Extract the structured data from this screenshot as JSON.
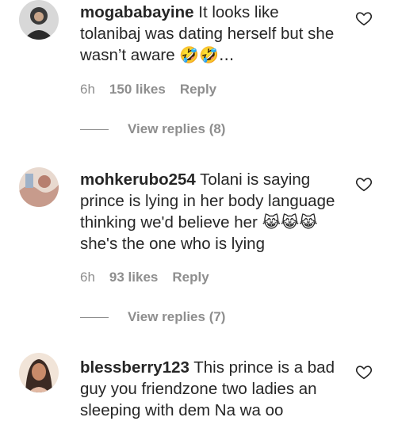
{
  "comments": [
    {
      "username": "mogababayine",
      "text": "It looks like tolanibaj was dating herself but she wasn’t aware",
      "emoji_trail": "🤣🤣...",
      "time": "6h",
      "likes": "150 likes",
      "reply": "Reply",
      "view_replies": "View replies (8)",
      "avatar_icon": "profile-avatar-icon"
    },
    {
      "username": "mohkerubo254",
      "text_line1": "Tolani is saying prince is lying in her body language thinking we'd believe her",
      "emoji_lead": "😹😹😹",
      "text_line2": "she's the one who is lying",
      "time": "6h",
      "likes": "93 likes",
      "reply": "Reply",
      "view_replies": "View replies (7)",
      "avatar_icon": "profile-avatar-icon"
    },
    {
      "username": "blessberry123",
      "text": "This prince is a bad guy you friendzone two ladies an sleeping with dem Na wa oo",
      "avatar_icon": "profile-avatar-icon"
    }
  ],
  "icons": {
    "like": "heart-outline-icon"
  },
  "colors": {
    "text": "#262626",
    "muted": "#8e8e8e",
    "background": "#ffffff"
  }
}
